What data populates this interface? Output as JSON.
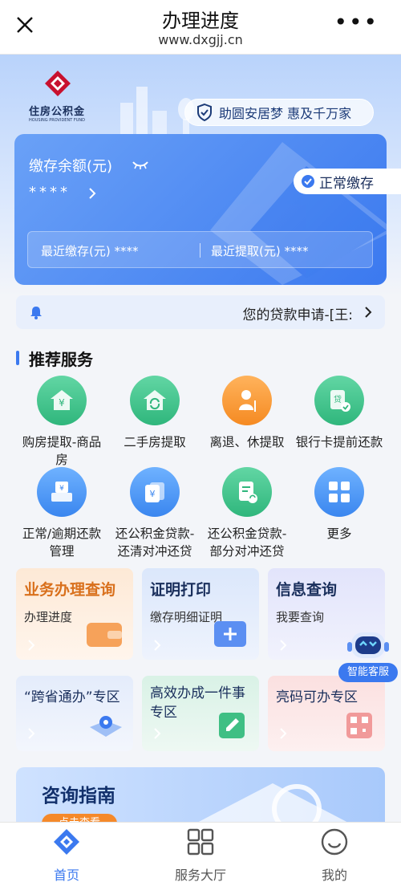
{
  "topbar": {
    "title": "办理进度",
    "url": "www.dxgjj.cn",
    "close_icon": "close-icon",
    "more_icon": "more-icon"
  },
  "header": {
    "logo_name": "住房公积金",
    "logo_sub": "HOUSING PROVIDENT FUND",
    "slogan": "助圆安居梦  惠及千万家"
  },
  "balance_card": {
    "label": "缴存余额(元)",
    "value": "****",
    "status": "正常缴存",
    "recent_deposit": "最近缴存(元)  ****",
    "recent_withdraw": "最近提取(元)  ****"
  },
  "notice": {
    "text": "您的贷款申请-[王:"
  },
  "services": {
    "title": "推荐服务",
    "items": [
      {
        "label": "购房提取-商品房"
      },
      {
        "label": "二手房提取"
      },
      {
        "label": "离退、休提取"
      },
      {
        "label": "银行卡提前还款"
      },
      {
        "label": "正常/逾期还款管理"
      },
      {
        "label": "还公积金贷款-还清对冲还贷"
      },
      {
        "label": "还公积金贷款-部分对冲还贷"
      },
      {
        "label": "更多"
      }
    ]
  },
  "tiles": [
    {
      "title": "业务办理查询",
      "sub": "办理进度"
    },
    {
      "title": "证明打印",
      "sub": "缴存明细证明"
    },
    {
      "title": "信息查询",
      "sub": "我要查询"
    },
    {
      "title": "“跨省通办”专区",
      "sub": ""
    },
    {
      "title": "高效办成一件事专区",
      "sub": ""
    },
    {
      "title": "亮码可办专区",
      "sub": ""
    }
  ],
  "assistant": {
    "label": "智能客服"
  },
  "consult": {
    "title": "咨询指南",
    "button": "点击查看"
  },
  "tabbar": {
    "items": [
      {
        "label": "首页",
        "active": true
      },
      {
        "label": "服务大厅",
        "active": false
      },
      {
        "label": "我的",
        "active": false
      }
    ]
  },
  "colors": {
    "primary": "#3b79ef",
    "orange": "#f58a22",
    "green": "#2fb67c"
  }
}
